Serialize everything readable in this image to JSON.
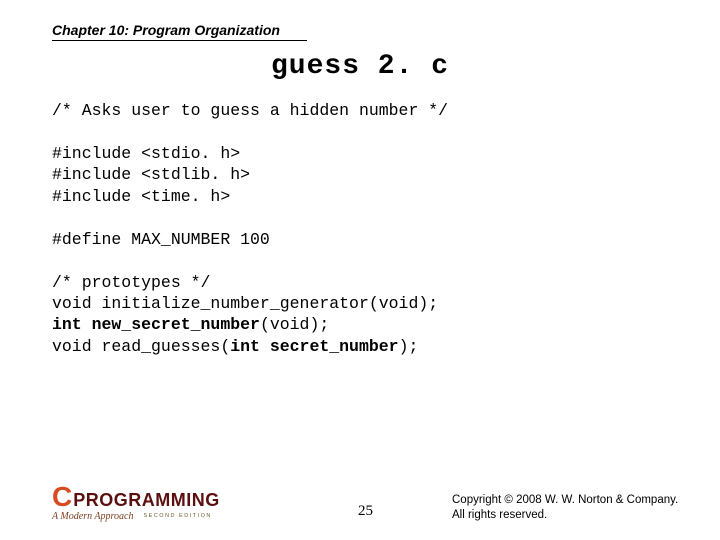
{
  "chapter": "Chapter 10: Program Organization",
  "title": "guess 2. c",
  "code": {
    "l1": "/* Asks user to guess a hidden number */",
    "l2": "",
    "l3": "#include <stdio. h>",
    "l4": "#include <stdlib. h>",
    "l5": "#include <time. h>",
    "l6": "",
    "l7": "#define MAX_NUMBER 100",
    "l8": "",
    "l9": "/* prototypes */",
    "l10a": "void initialize_number_generator(void);",
    "l11a": "int new_secret_number",
    "l11b": "(void);",
    "l12a": "void read_guesses(",
    "l12b": "int secret_number",
    "l12c": ");"
  },
  "logo": {
    "c": "C",
    "prog": "PROGRAMMING",
    "sub": "A Modern Approach",
    "ed": "SECOND EDITION"
  },
  "pagenum": "25",
  "copyright": {
    "line1": "Copyright © 2008 W. W. Norton & Company.",
    "line2": "All rights reserved."
  }
}
